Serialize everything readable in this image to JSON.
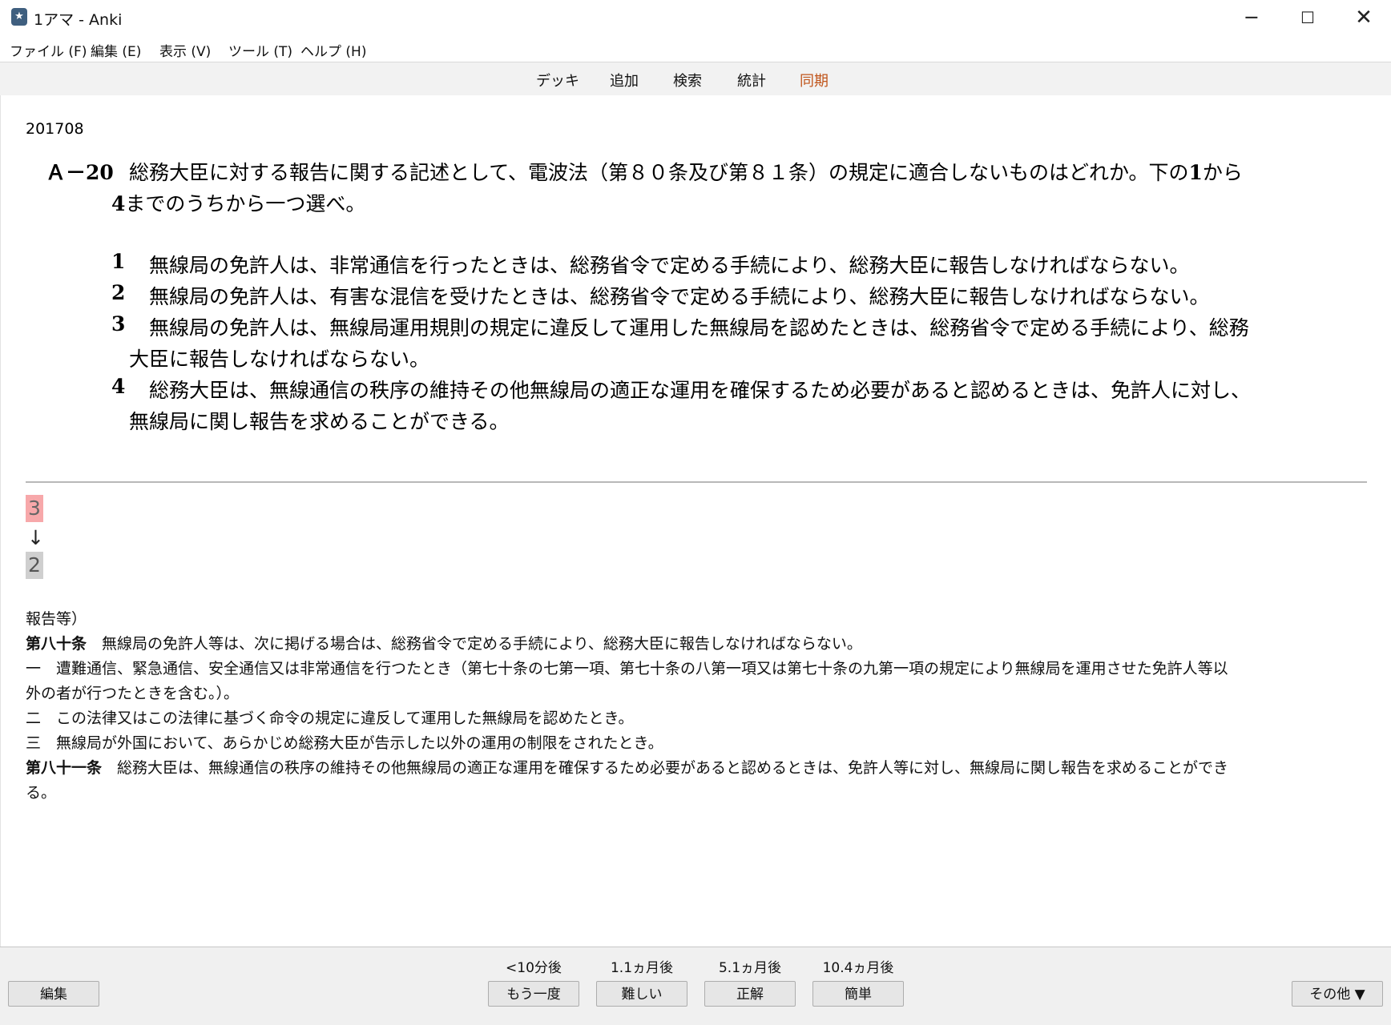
{
  "window": {
    "title": "1アマ - Anki",
    "icon": "anki-star-icon"
  },
  "menu": [
    "ファイル (F)",
    "編集 (E)",
    "表示 (V)",
    "ツール (T)",
    "ヘルプ (H)"
  ],
  "toolbar": {
    "decks": "デッキ",
    "add": "追加",
    "browse": "検索",
    "stats": "統計",
    "sync": "同期",
    "sync_color": "#c0541a"
  },
  "card": {
    "id": "201708",
    "question_label": "Ａ－20",
    "question_line1": "総務大臣に対する報告に関する記述として、電波法（第８０条及び第８１条）の規定に適合しないものはどれか。下の",
    "question_num1": "1",
    "question_tail1": "から",
    "question_num2": "4",
    "question_line2": "までのうちから一つ選べ。",
    "options": [
      {
        "num": "1",
        "lines": [
          "無線局の免許人は、非常通信を行ったときは、総務省令で定める手続により、総務大臣に報告しなければならない。"
        ]
      },
      {
        "num": "2",
        "lines": [
          "無線局の免許人は、有害な混信を受けたときは、総務省令で定める手続により、総務大臣に報告しなければならない。"
        ]
      },
      {
        "num": "3",
        "lines": [
          "無線局の免許人は、無線局運用規則の規定に違反して運用した無線局を認めたときは、総務省令で定める手続により、総務",
          "大臣に報告しなければならない。"
        ]
      },
      {
        "num": "4",
        "lines": [
          "総務大臣は、無線通信の秩序の維持その他無線局の適正な運用を確保するため必要があると認めるときは、免許人に対し、",
          "無線局に関し報告を求めることができる。"
        ]
      }
    ],
    "answer_typed": "3",
    "answer_arrow": "↓",
    "answer_correct": "2",
    "answer_wrong_color": "#f7a8aa",
    "answer_correct_color": "#cfcfcf",
    "law": {
      "heading": "報告等）",
      "art80_title": "第八十条",
      "art80_text": "無線局の免許人等は、次に掲げる場合は、総務省令で定める手続により、総務大臣に報告しなければならない。",
      "item1_num": "一",
      "item1_text": "遭難通信、緊急通信、安全通信又は非常通信を行つたとき（第七十条の七第一項、第七十条の八第一項又は第七十条の九第一項の規定により無線局を運用させた免許人等以",
      "item1_cont": "外の者が行つたときを含む。）。",
      "item2_num": "二",
      "item2_text": "この法律又はこの法律に基づく命令の規定に違反して運用した無線局を認めたとき。",
      "item3_num": "三",
      "item3_text": "無線局が外国において、あらかじめ総務大臣が告示した以外の運用の制限をされたとき。",
      "art81_title": "第八十一条",
      "art81_text": "総務大臣は、無線通信の秩序の維持その他無線局の適正な運用を確保するため必要があると認めるときは、免許人等に対し、無線局に関し報告を求めることができ",
      "art81_cont": "る。"
    }
  },
  "bottom": {
    "edit": "編集",
    "intervals": [
      "<10分後",
      "1.1ヵ月後",
      "5.1ヵ月後",
      "10.4ヵ月後"
    ],
    "answers": [
      "もう一度",
      "難しい",
      "正解",
      "簡単"
    ],
    "more": "その他 ▼"
  }
}
